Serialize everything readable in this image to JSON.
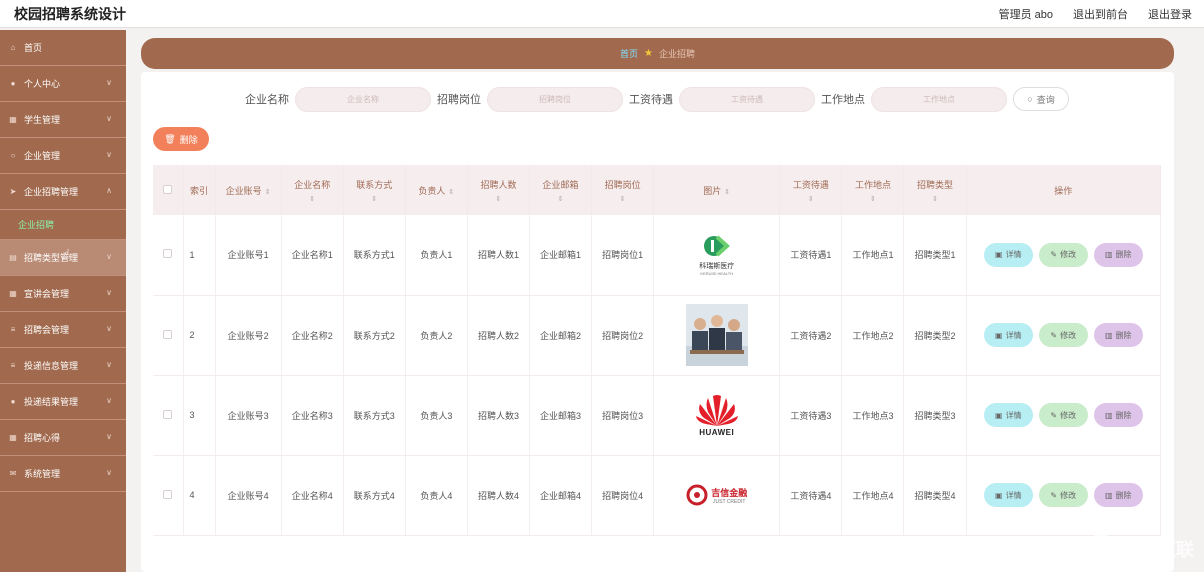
{
  "app": {
    "title": "校园招聘系统设计"
  },
  "topbar": {
    "user": "管理员 abo",
    "front": "退出到前台",
    "logout": "退出登录"
  },
  "sidebar": {
    "items": [
      {
        "label": "首页",
        "icon": "home-icon"
      },
      {
        "label": "个人中心",
        "icon": "user-icon"
      },
      {
        "label": "学生管理",
        "icon": "grid-icon"
      },
      {
        "label": "企业管理",
        "icon": "circle-icon"
      },
      {
        "label": "企业招聘管理",
        "icon": "send-icon"
      },
      {
        "label": "企业招聘",
        "sub": true
      },
      {
        "label": "招聘类型管理",
        "icon": "doc-icon"
      },
      {
        "label": "宣讲会管理",
        "icon": "grid-icon"
      },
      {
        "label": "招聘会管理",
        "icon": "list-icon"
      },
      {
        "label": "投递信息管理",
        "icon": "list-icon"
      },
      {
        "label": "投递结果管理",
        "icon": "user-icon"
      },
      {
        "label": "招聘心得",
        "icon": "grid-icon"
      },
      {
        "label": "系统管理",
        "icon": "mail-icon"
      }
    ]
  },
  "breadcrumb": {
    "home": "首页",
    "current": "企业招聘"
  },
  "search": {
    "fields": [
      {
        "label": "企业名称",
        "placeholder": "企业名称"
      },
      {
        "label": "招聘岗位",
        "placeholder": "招聘岗位"
      },
      {
        "label": "工资待遇",
        "placeholder": "工资待遇"
      },
      {
        "label": "工作地点",
        "placeholder": "工作地点"
      }
    ],
    "query_label": "查询"
  },
  "toolbar": {
    "delete_label": "删除"
  },
  "table": {
    "headers": {
      "index": "索引",
      "account": "企业账号",
      "name": "企业名称",
      "contact": "联系方式",
      "owner": "负责人",
      "count": "招聘人数",
      "email": "企业邮箱",
      "position": "招聘岗位",
      "image": "图片",
      "salary": "工资待遇",
      "location": "工作地点",
      "type": "招聘类型",
      "ops": "操作"
    },
    "rows": [
      {
        "index": "1",
        "account": "企业账号1",
        "name": "企业名称1",
        "contact": "联系方式1",
        "owner": "负责人1",
        "count": "招聘人数1",
        "email": "企业邮箱1",
        "position": "招聘岗位1",
        "logo_text": "科瑞斯医疗",
        "logo_sub": "KERUISI HEALTH",
        "salary": "工资待遇1",
        "location": "工作地点1",
        "type": "招聘类型1"
      },
      {
        "index": "2",
        "account": "企业账号2",
        "name": "企业名称2",
        "contact": "联系方式2",
        "owner": "负责人2",
        "count": "招聘人数2",
        "email": "企业邮箱2",
        "position": "招聘岗位2",
        "salary": "工资待遇2",
        "location": "工作地点2",
        "type": "招聘类型2"
      },
      {
        "index": "3",
        "account": "企业账号3",
        "name": "企业名称3",
        "contact": "联系方式3",
        "owner": "负责人3",
        "count": "招聘人数3",
        "email": "企业邮箱3",
        "position": "招聘岗位3",
        "logo_text": "HUAWEI",
        "salary": "工资待遇3",
        "location": "工作地点3",
        "type": "招聘类型3"
      },
      {
        "index": "4",
        "account": "企业账号4",
        "name": "企业名称4",
        "contact": "联系方式4",
        "owner": "负责人4",
        "count": "招聘人数4",
        "email": "企业邮箱4",
        "position": "招聘岗位4",
        "logo_text": "吉信金融",
        "logo_sub": "JUST CREDIT",
        "salary": "工资待遇4",
        "location": "工作地点4",
        "type": "招聘类型4"
      }
    ],
    "ops": {
      "detail": "详情",
      "edit": "修改",
      "remove": "删除"
    }
  },
  "watermark": {
    "text": "创新互联"
  }
}
